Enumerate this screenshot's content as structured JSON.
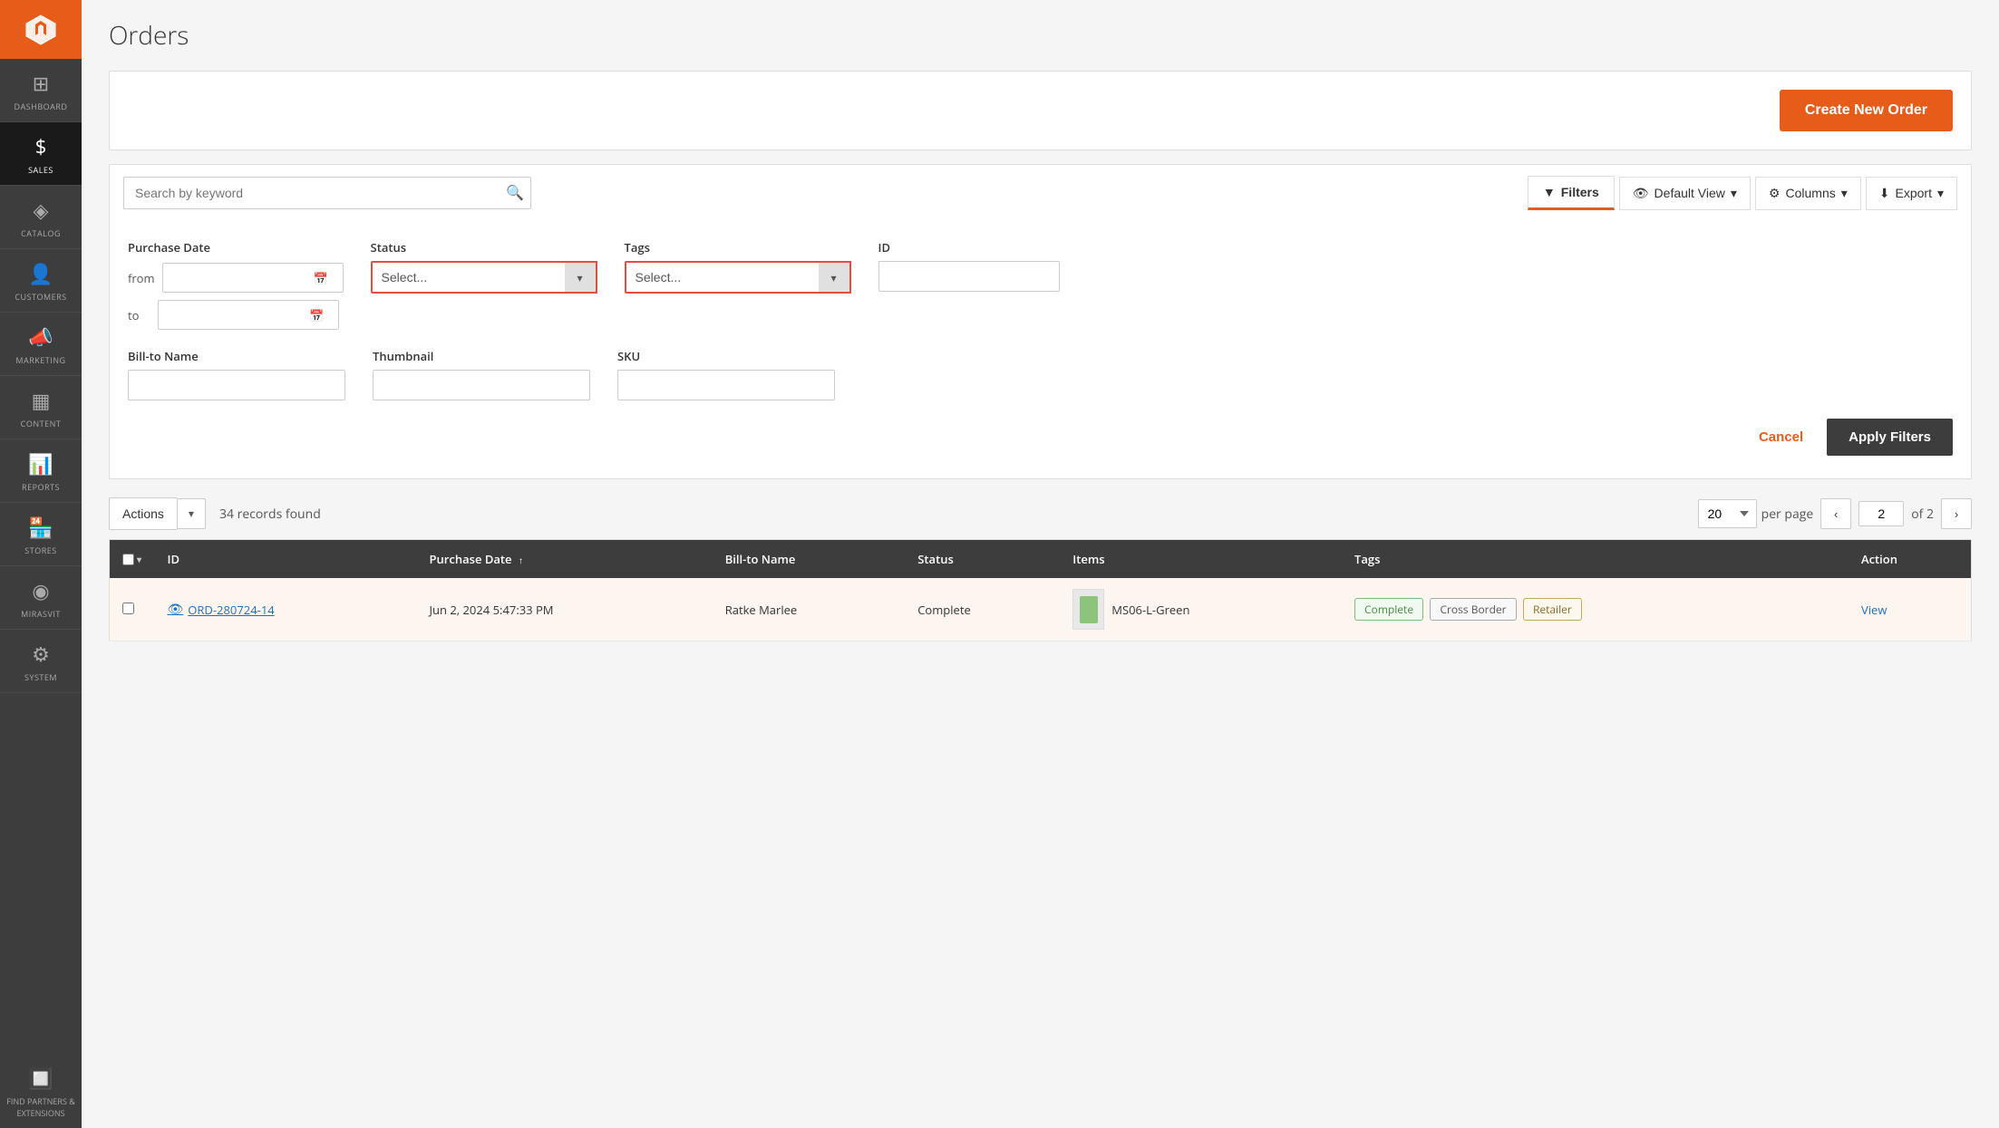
{
  "sidebar": {
    "logo_alt": "Magento Logo",
    "items": [
      {
        "id": "dashboard",
        "label": "DASHBOARD",
        "icon": "⊞"
      },
      {
        "id": "sales",
        "label": "SALES",
        "icon": "$",
        "active": true
      },
      {
        "id": "catalog",
        "label": "CATALOG",
        "icon": "◈"
      },
      {
        "id": "customers",
        "label": "CUSTOMERS",
        "icon": "👤"
      },
      {
        "id": "marketing",
        "label": "MARKETING",
        "icon": "📣"
      },
      {
        "id": "content",
        "label": "CONTENT",
        "icon": "▦"
      },
      {
        "id": "reports",
        "label": "REPORTS",
        "icon": "📊"
      },
      {
        "id": "stores",
        "label": "STORES",
        "icon": "🏪"
      },
      {
        "id": "mirasvit",
        "label": "MIRASVIT",
        "icon": "◉"
      },
      {
        "id": "system",
        "label": "SYSTEM",
        "icon": "⚙"
      }
    ],
    "partners_label": "FIND PARTNERS & EXTENSIONS",
    "partners_icon": "🔲"
  },
  "page": {
    "title": "Orders"
  },
  "toolbar": {
    "create_button_label": "Create New Order"
  },
  "search": {
    "placeholder": "Search by keyword"
  },
  "filter_bar": {
    "filters_label": "Filters",
    "view_label": "Default View",
    "columns_label": "Columns",
    "export_label": "Export"
  },
  "filters": {
    "purchase_date_label": "Purchase Date",
    "from_label": "from",
    "to_label": "to",
    "status_label": "Status",
    "status_placeholder": "Select...",
    "tags_label": "Tags",
    "tags_placeholder": "Select...",
    "id_label": "ID",
    "bill_to_name_label": "Bill-to Name",
    "thumbnail_label": "Thumbnail",
    "sku_label": "SKU",
    "cancel_label": "Cancel",
    "apply_label": "Apply Filters"
  },
  "table_toolbar": {
    "actions_label": "Actions",
    "records_found": "34 records found",
    "per_page_value": "20",
    "per_page_label": "per page",
    "current_page": "2",
    "total_pages": "of 2"
  },
  "table": {
    "columns": [
      "",
      "ID",
      "Purchase Date",
      "Bill-to Name",
      "Status",
      "Items",
      "Tags",
      "Action"
    ],
    "rows": [
      {
        "id": "ORD-280724-14",
        "purchase_date": "Jun 2, 2024 5:47:33 PM",
        "bill_to_name": "Ratke Marlee",
        "status": "Complete",
        "item_sku": "MS06-L-Green",
        "tags": [
          "Complete",
          "Cross Border",
          "Retailer"
        ],
        "action": "View"
      }
    ]
  }
}
